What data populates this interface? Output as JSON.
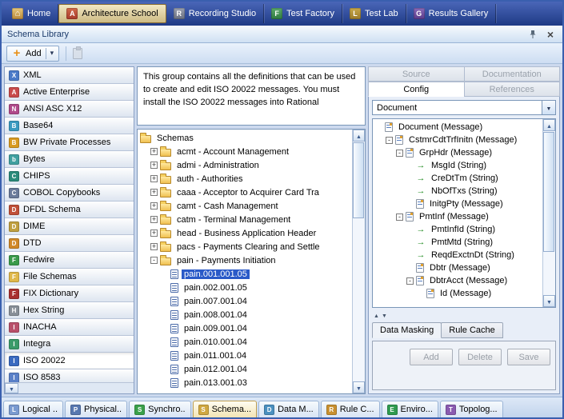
{
  "colors": {
    "selection": "#2a5ac8",
    "topbar-dark": "#1e3a85",
    "topbar-light": "#4a66b8",
    "active-tab": "#cdbb84"
  },
  "top_tabs": {
    "items": [
      {
        "label": "Home",
        "icon": "home-icon",
        "active": false
      },
      {
        "label": "Architecture School",
        "icon": "architecture-school-icon",
        "active": true
      },
      {
        "label": "Recording Studio",
        "icon": "recording-studio-icon",
        "active": false
      },
      {
        "label": "Test Factory",
        "icon": "test-factory-icon",
        "active": false
      },
      {
        "label": "Test Lab",
        "icon": "test-lab-icon",
        "active": false
      },
      {
        "label": "Results Gallery",
        "icon": "results-gallery-icon",
        "active": false
      }
    ]
  },
  "panel": {
    "title": "Schema Library",
    "title_icons": [
      "pin-icon",
      "close-icon"
    ]
  },
  "toolbar": {
    "add_label": "Add",
    "icons": [
      "add-plus-icon",
      "chevron-down-icon",
      "paste-icon"
    ]
  },
  "sidebar": {
    "items": [
      {
        "label": "XML",
        "icon": "xml-icon",
        "selected": false
      },
      {
        "label": "Active Enterprise",
        "icon": "active-enterprise-icon",
        "selected": false
      },
      {
        "label": "ANSI ASC X12",
        "icon": "ansi-icon",
        "selected": false
      },
      {
        "label": "Base64",
        "icon": "base64-icon",
        "selected": false
      },
      {
        "label": "BW Private Processes",
        "icon": "bw-icon",
        "selected": false
      },
      {
        "label": "Bytes",
        "icon": "bytes-icon",
        "selected": false
      },
      {
        "label": "CHIPS",
        "icon": "chips-icon",
        "selected": false
      },
      {
        "label": "COBOL Copybooks",
        "icon": "cobol-icon",
        "selected": false
      },
      {
        "label": "DFDL Schema",
        "icon": "dfdl-icon",
        "selected": false
      },
      {
        "label": "DIME",
        "icon": "dime-icon",
        "selected": false
      },
      {
        "label": "DTD",
        "icon": "dtd-icon",
        "selected": false
      },
      {
        "label": "Fedwire",
        "icon": "fedwire-icon",
        "selected": false
      },
      {
        "label": "File Schemas",
        "icon": "file-schemas-icon",
        "selected": false
      },
      {
        "label": "FIX Dictionary",
        "icon": "fix-icon",
        "selected": false
      },
      {
        "label": "Hex String",
        "icon": "hex-icon",
        "selected": false
      },
      {
        "label": "INACHA",
        "icon": "inacha-icon",
        "selected": false
      },
      {
        "label": "Integra",
        "icon": "integra-icon",
        "selected": false
      },
      {
        "label": "ISO 20022",
        "icon": "iso20022-icon",
        "selected": true
      },
      {
        "label": "ISO 8583",
        "icon": "iso8583-icon",
        "selected": false
      }
    ]
  },
  "group_description": "This group contains all the definitions that can be used to create and edit ISO 20022 messages. You must install the ISO 20022 messages into Rational",
  "schema_tree": {
    "root_label": "Schemas",
    "items": [
      {
        "label": "acmt - Account Management",
        "depth": 1,
        "expander": "plus",
        "icon": "folder-icon",
        "selected": false
      },
      {
        "label": "admi - Administration",
        "depth": 1,
        "expander": "plus",
        "icon": "folder-icon",
        "selected": false
      },
      {
        "label": "auth - Authorities",
        "depth": 1,
        "expander": "plus",
        "icon": "folder-icon",
        "selected": false
      },
      {
        "label": "caaa - Acceptor to Acquirer Card Tra",
        "depth": 1,
        "expander": "plus",
        "icon": "folder-icon",
        "selected": false
      },
      {
        "label": "camt - Cash Management",
        "depth": 1,
        "expander": "plus",
        "icon": "folder-icon",
        "selected": false
      },
      {
        "label": "catm - Terminal Management",
        "depth": 1,
        "expander": "plus",
        "icon": "folder-icon",
        "selected": false
      },
      {
        "label": "head - Business Application Header",
        "depth": 1,
        "expander": "plus",
        "icon": "folder-icon",
        "selected": false
      },
      {
        "label": "pacs - Payments Clearing and Settle",
        "depth": 1,
        "expander": "plus",
        "icon": "folder-icon",
        "selected": false
      },
      {
        "label": "pain - Payments Initiation",
        "depth": 1,
        "expander": "minus",
        "icon": "folder-icon",
        "selected": false
      },
      {
        "label": "pain.001.001.05",
        "depth": 2,
        "expander": "none",
        "icon": "schema-file-icon",
        "selected": true
      },
      {
        "label": "pain.002.001.05",
        "depth": 2,
        "expander": "none",
        "icon": "schema-file-icon",
        "selected": false
      },
      {
        "label": "pain.007.001.04",
        "depth": 2,
        "expander": "none",
        "icon": "schema-file-icon",
        "selected": false
      },
      {
        "label": "pain.008.001.04",
        "depth": 2,
        "expander": "none",
        "icon": "schema-file-icon",
        "selected": false
      },
      {
        "label": "pain.009.001.04",
        "depth": 2,
        "expander": "none",
        "icon": "schema-file-icon",
        "selected": false
      },
      {
        "label": "pain.010.001.04",
        "depth": 2,
        "expander": "none",
        "icon": "schema-file-icon",
        "selected": false
      },
      {
        "label": "pain.011.001.04",
        "depth": 2,
        "expander": "none",
        "icon": "schema-file-icon",
        "selected": false
      },
      {
        "label": "pain.012.001.04",
        "depth": 2,
        "expander": "none",
        "icon": "schema-file-icon",
        "selected": false
      },
      {
        "label": "pain.013.001.03",
        "depth": 2,
        "expander": "none",
        "icon": "schema-file-icon",
        "selected": false
      }
    ]
  },
  "right_panel": {
    "tabs_row1": [
      {
        "label": "Source",
        "state": "disabled"
      },
      {
        "label": "Documentation",
        "state": "disabled"
      }
    ],
    "tabs_row2": [
      {
        "label": "Config",
        "state": "active"
      },
      {
        "label": "References",
        "state": "disabled"
      }
    ],
    "document_select": {
      "value": "Document"
    },
    "config_tree": [
      {
        "label": "Document (Message)",
        "depth": 0,
        "expander": "none",
        "icon": "message-icon"
      },
      {
        "label": "CstmrCdtTrfInitn (Message)",
        "depth": 1,
        "expander": "minus",
        "icon": "message-icon"
      },
      {
        "label": "GrpHdr (Message)",
        "depth": 2,
        "expander": "minus",
        "icon": "message-icon"
      },
      {
        "label": "MsgId (String)",
        "depth": 3,
        "expander": "none",
        "icon": "string-field-icon"
      },
      {
        "label": "CreDtTm (String)",
        "depth": 3,
        "expander": "none",
        "icon": "string-field-icon"
      },
      {
        "label": "NbOfTxs (String)",
        "depth": 3,
        "expander": "none",
        "icon": "string-field-icon"
      },
      {
        "label": "InitgPty (Message)",
        "depth": 3,
        "expander": "none",
        "icon": "message-icon"
      },
      {
        "label": "PmtInf (Message)",
        "depth": 2,
        "expander": "minus",
        "icon": "message-icon"
      },
      {
        "label": "PmtInfId (String)",
        "depth": 3,
        "expander": "none",
        "icon": "string-field-icon"
      },
      {
        "label": "PmtMtd (String)",
        "depth": 3,
        "expander": "none",
        "icon": "string-field-icon"
      },
      {
        "label": "ReqdExctnDt (String)",
        "depth": 3,
        "expander": "none",
        "icon": "string-field-icon"
      },
      {
        "label": "Dbtr (Message)",
        "depth": 3,
        "expander": "none",
        "icon": "message-icon"
      },
      {
        "label": "DbtrAcct (Message)",
        "depth": 3,
        "expander": "minus",
        "icon": "message-icon"
      },
      {
        "label": "Id (Message)",
        "depth": 4,
        "expander": "none",
        "icon": "message-icon"
      }
    ],
    "bottom_tabs": [
      {
        "label": "Data Masking",
        "state": "active"
      },
      {
        "label": "Rule Cache",
        "state": "inactive"
      }
    ],
    "buttons": [
      {
        "label": "Add",
        "state": "disabled"
      },
      {
        "label": "Delete",
        "state": "disabled"
      },
      {
        "label": "Save",
        "state": "disabled"
      }
    ]
  },
  "bottom_tabs": {
    "items": [
      {
        "label": "Logical ..",
        "icon": "logical-view-icon",
        "active": false
      },
      {
        "label": "Physical..",
        "icon": "physical-view-icon",
        "active": false
      },
      {
        "label": "Synchro..",
        "icon": "synchronize-icon",
        "active": false
      },
      {
        "label": "Schema...",
        "icon": "schema-library-icon",
        "active": true
      },
      {
        "label": "Data M...",
        "icon": "data-model-icon",
        "active": false
      },
      {
        "label": "Rule C...",
        "icon": "rule-cache-icon",
        "active": false
      },
      {
        "label": "Enviro...",
        "icon": "environments-icon",
        "active": false
      },
      {
        "label": "Topolog...",
        "icon": "topology-icon",
        "active": false
      }
    ]
  }
}
